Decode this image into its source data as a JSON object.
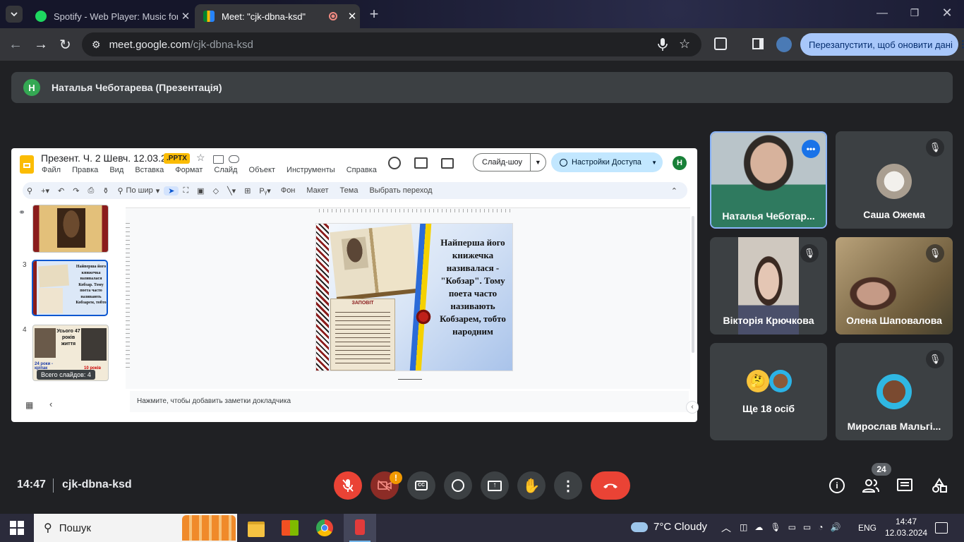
{
  "tabs": [
    {
      "title": "Spotify - Web Player: Music for"
    },
    {
      "title": "Meet: \"cjk-dbna-ksd\""
    }
  ],
  "address": {
    "host": "meet.google.com",
    "path": "/cjk-dbna-ksd"
  },
  "relaunch_label": "Перезапустити, щоб оновити дані",
  "presenter": {
    "initial": "Н",
    "label": "Наталья Чеботарева (Презентація)"
  },
  "slides_app": {
    "doc_title": "Презент. Ч. 2 Шевч. 12.03.24",
    "badge": ".PPTX",
    "menus": [
      "Файл",
      "Правка",
      "Вид",
      "Вставка",
      "Формат",
      "Слайд",
      "Объект",
      "Инструменты",
      "Справка"
    ],
    "slideshow_label": "Слайд-шоу",
    "share_label": "Настройки Доступа",
    "user_initial": "Н",
    "zoom_label": "По шир",
    "toolbar_text": [
      "Фон",
      "Макет",
      "Тема",
      "Выбрать переход"
    ],
    "slide_numbers": [
      "3",
      "4"
    ],
    "tooltip": "Всего слайдов: 4",
    "notes_placeholder": "Нажмите, чтобы добавить заметки докладчика",
    "thumb3_text": "Найперша його книжечка називалася Кобзар. Тому поета часто називають Кобзарем, тобто",
    "thumb4_text": "Усього 47 років життя",
    "thumb4_left": "24 роки - кріпак",
    "thumb4_right": "10 років",
    "slide_text": "Найперша його книжечка називалася - \"Кобзар\". Тому поета часто називають Кобзарем, тобто народним",
    "zapovit": "ЗАПОВІТ"
  },
  "participants": [
    {
      "name": "Наталья Чеботар..."
    },
    {
      "name": "Саша Ожема"
    },
    {
      "name": "Вікторія Крючкова"
    },
    {
      "name": "Олена Шаповалова"
    },
    {
      "name": "Ще 18 осіб"
    },
    {
      "name": "Мирослав Мальгі..."
    }
  ],
  "meeting": {
    "time": "14:47",
    "code": "cjk-dbna-ksd",
    "people_count": "24",
    "cam_alert": "!"
  },
  "taskbar": {
    "search": "Пошук",
    "weather": "7°C  Cloudy",
    "lang": "ENG",
    "time": "14:47",
    "date": "12.03.2024"
  },
  "colors": {
    "red": "#ea4335",
    "accent": "#8ab4f8",
    "pptx_badge": "#fbbc04",
    "highlight_blue": "#1a73e8"
  }
}
